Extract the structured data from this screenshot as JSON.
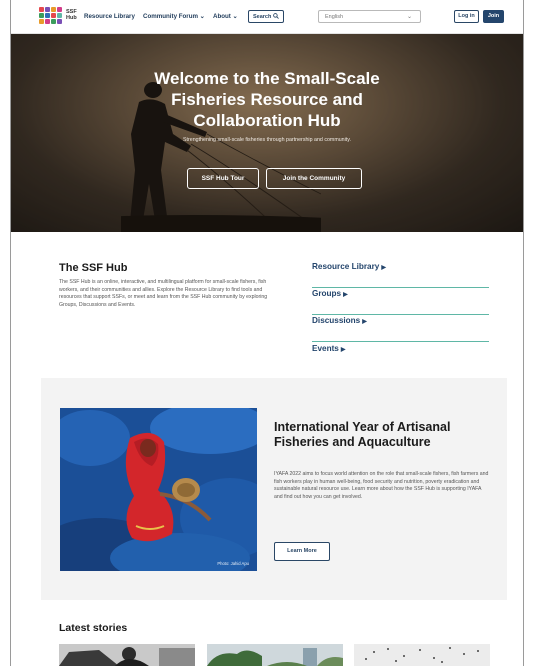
{
  "nav": {
    "logo_text_line1": "SSF",
    "logo_text_line2": "Hub",
    "links": [
      "Resource Library",
      "Community Forum",
      "About"
    ],
    "dropdown_caret": "⌄",
    "search_label": "Search",
    "language_value": "English",
    "login_label": "Log in",
    "join_label": "Join"
  },
  "hero": {
    "title_line1": "Welcome to the Small-Scale",
    "title_line2": "Fisheries Resource and",
    "title_line3": "Collaboration Hub",
    "subtitle": "Strengthening small-scale fisheries through partnership and community.",
    "tour_button": "SSF Hub Tour",
    "join_button": "Join the Community"
  },
  "about": {
    "title": "The SSF Hub",
    "body": "The SSF Hub is an online, interactive, and multilingual platform for small-scale fishers, fish workers, and their communities and allies. Explore the Resource Library to find tools and resources that support SSFs, or meet and learn from the SSF Hub community by exploring Groups, Discussions and Events.",
    "links": [
      "Resource Library",
      "Groups",
      "Discussions",
      "Events"
    ]
  },
  "feature": {
    "title": "International Year of Artisanal Fisheries and Aquaculture",
    "body": "IYAFA 2022 aims to focus world attention on the role that small-scale fishers, fish farmers and fish workers play in human well-being, food security and nutrition, poverty eradication and sustainable natural resource use. Learn more about how the SSF Hub is supporting IYAFA and find out how you can get involved.",
    "button": "Learn More",
    "photo_credit": "Photo: Jahid Apu"
  },
  "stories": {
    "title": "Latest stories"
  },
  "colors": {
    "brand_navy": "#24456c",
    "link_underline": "#5fb7a6",
    "feature_bg": "#f3f3f3"
  }
}
